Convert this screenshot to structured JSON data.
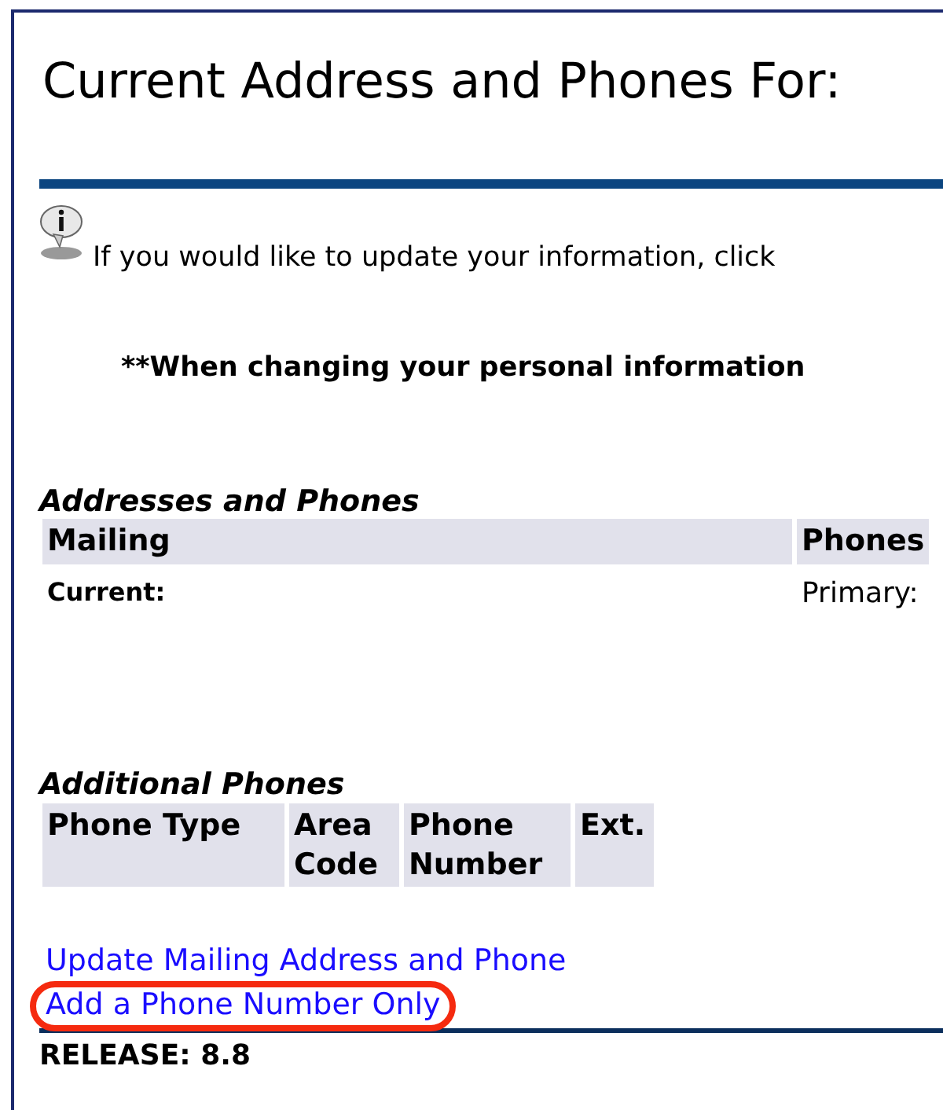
{
  "title": "Current Address and Phones For:",
  "info": {
    "text": "If you would like to update your information, click"
  },
  "notice": "**When changing your personal information",
  "addresses": {
    "heading": "Addresses and Phones",
    "columns": [
      "Mailing",
      "Phones"
    ],
    "row": [
      "Current:",
      "Primary:"
    ]
  },
  "additional_phones": {
    "heading": "Additional Phones",
    "columns": [
      "Phone Type",
      "Area Code",
      "Phone Number",
      "Ext."
    ]
  },
  "links": [
    {
      "label": "Update Mailing Address and Phone",
      "highlighted": false
    },
    {
      "label": "Add a Phone Number Only",
      "highlighted": true
    }
  ],
  "release": "RELEASE: 8.8"
}
